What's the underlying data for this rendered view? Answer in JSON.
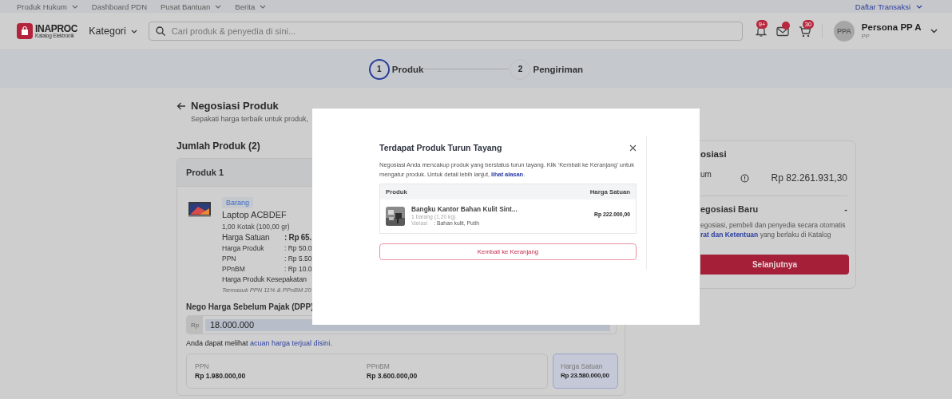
{
  "top_links": [
    {
      "label": "Produk Hukum",
      "dropdown": true
    },
    {
      "label": "Dashboard PDN",
      "dropdown": false
    },
    {
      "label": "Pusat Bantuan",
      "dropdown": true
    },
    {
      "label": "Berita",
      "dropdown": true
    }
  ],
  "account_link": {
    "label": "Daftar Transaksi",
    "dropdown": true
  },
  "header": {
    "logo": {
      "name": "INAPROC",
      "tagline": "Katalog Elektronik"
    },
    "category": "Kategori",
    "search": {
      "placeholder": "Cari produk & penyedia di sini..."
    },
    "notifications": {
      "badge": "9+"
    },
    "messages": {
      "unread": true
    },
    "cart": {
      "badge": "30"
    },
    "user": {
      "initials": "PPA",
      "name": "Persona PP A",
      "role": "PP"
    }
  },
  "stepper": [
    {
      "number": "1",
      "label": "Produk",
      "selected": true
    },
    {
      "number": "2",
      "label": "Pengiriman",
      "selected": false
    }
  ],
  "page": {
    "title": "Negosiasi Produk",
    "subtitle": "Sepakati harga terbaik untuk produk,",
    "product_count": "Jumlah Produk (2)"
  },
  "product": {
    "header": "Produk 1",
    "tag": "Barang",
    "name": "Laptop ACBDEF",
    "quantity": "1,00 Kotak (100,00 gr)",
    "prices": [
      {
        "kind": "major",
        "label": "Harga Satuan",
        "value": ": Rp 65."
      },
      {
        "kind": "minor",
        "label": "Harga Produk",
        "value": ": Rp 50.0"
      },
      {
        "kind": "minor",
        "label": "PPN",
        "value": ": Rp 5.50"
      },
      {
        "kind": "minor",
        "label": "PPnBM",
        "value": ": Rp 10.0"
      },
      {
        "kind": "major",
        "label": "Harga Produk Kesepakatan"
      }
    ],
    "agreement_note": "Termasuk PPN 11% & PPnBM 20",
    "nego": {
      "label": "Nego Harga Sebelum Pajak (DPP)",
      "prefix": "Rp",
      "value": "18.000.000",
      "hint": "Anda dapat melihat",
      "hint_link": "acuan harga terjual disini."
    },
    "totals": [
      {
        "label": "PPN",
        "value": "Rp 1.980.000,00",
        "highlighted": false
      },
      {
        "label": "PPnBM",
        "value": "Rp 3.600.000,00",
        "highlighted": false
      },
      {
        "label": "Harga Satuan",
        "value": "Rp 23.580.000,00",
        "highlighted": true
      }
    ]
  },
  "summary": {
    "title": "osiasi",
    "row_label": "um",
    "amount": "Rp 82.261.931,30",
    "section": "egosiasi Baru",
    "section_value": "-",
    "text_line": "egosiasi, pembeli dan penyedia secara otomatis",
    "link": "rat dan Ketentuan",
    "text_after": " yang berlaku di Katalog",
    "button": "Selanjutnya"
  },
  "dialog": {
    "title": "Terdapat Produk Turun Tayang",
    "message": "Negosiasi Anda mencakup produk yang berstatus turun tayang. Klik ‘Kembali ke Keranjang’ untuk mengatur produk. Untuk detail lebih lanjut, ",
    "link": "lihat alasan",
    "message_end": ".",
    "columns": [
      "Produk",
      "Harga Satuan"
    ],
    "rows": [
      {
        "name": "Bangku Kantor Bahan Kulit Sint...",
        "quantity": "1 barang (1,20 kg)",
        "variant_label": "Variasi",
        "variant_value": ": Bahan kulit, Putih",
        "price": "Rp 222.000,00"
      }
    ],
    "button": "Kembali ke Keranjang"
  }
}
